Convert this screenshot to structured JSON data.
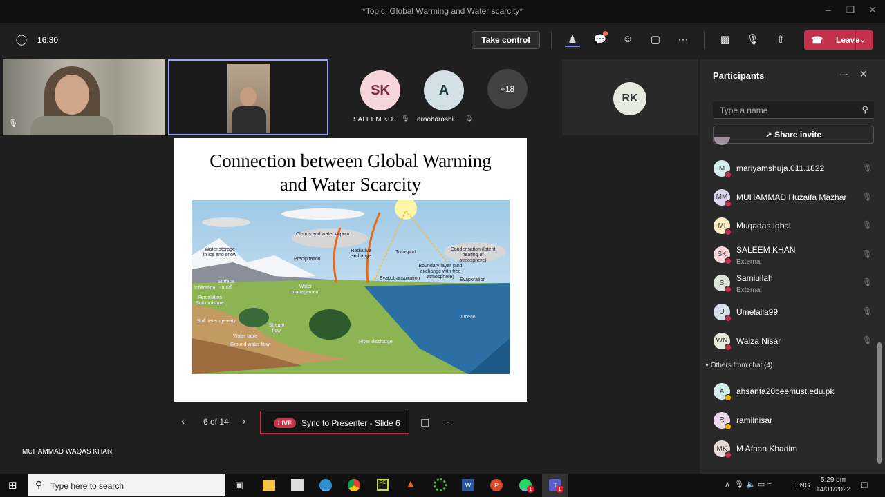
{
  "window": {
    "title": "*Topic: Global Warming and Water scarcity*"
  },
  "toolbar": {
    "timer": "16:30",
    "take_control": "Take control",
    "leave": "Leave"
  },
  "videos": {
    "tiles": [
      {
        "name": "SALEEM KH...",
        "initials": "SK",
        "bg": "#f6d6db",
        "fg": "#7a2a3a"
      },
      {
        "name": "aroobarashi...",
        "initials": "A",
        "bg": "#d3e1e6",
        "fg": "#1f3b48"
      }
    ],
    "overflow": "+18",
    "rk": {
      "initials": "RK",
      "bg": "#e6ebdd",
      "fg": "#333"
    }
  },
  "slide": {
    "title_line1": "Connection between Global Warming",
    "title_line2": "and Water Scarcity",
    "labels": {
      "clouds": "Clouds and water vapour",
      "radiative": "Radiative exchange",
      "transport": "Transport",
      "condensation": "Condensation (latent heating of atmosphere)",
      "storage": "Water storage in ice and snow",
      "precipitation": "Precipitation",
      "boundary": "Boundary layer (and exchange with free atmosphere)",
      "evapotranspiration": "Evapotranspiration",
      "evaporation": "Evaporation",
      "runoff": "Surface runoff",
      "management": "Water management",
      "infiltration": "Infiltration",
      "percolation": "Percolation Soil moisture",
      "soil": "Soil heterogeneity",
      "stream": "Stream flow",
      "ocean": "Ocean",
      "table": "Water table",
      "ground": "Ground water flow",
      "river": "River discharge"
    }
  },
  "slide_nav": {
    "page": "6 of 14",
    "live": "LIVE",
    "sync": "Sync to Presenter - Slide 6"
  },
  "presenter": "MUHAMMAD WAQAS KHAN",
  "panel": {
    "title": "Participants",
    "search_placeholder": "Type a name",
    "share": "Share invite",
    "participants": [
      {
        "initials": "M",
        "name": "mariyamshuja.011.1822",
        "sub": "",
        "bg": "#d3ecec"
      },
      {
        "initials": "MM",
        "name": "MUHAMMAD Huzaifa Mazhar",
        "sub": "",
        "bg": "#dcd6ef"
      },
      {
        "initials": "MI",
        "name": "Muqadas Iqbal",
        "sub": "",
        "bg": "#fbedc4"
      },
      {
        "initials": "SK",
        "name": "SALEEM KHAN",
        "sub": "External",
        "bg": "#f6d6db"
      },
      {
        "initials": "S",
        "name": "Samiullah",
        "sub": "External",
        "bg": "#dde5d8"
      },
      {
        "initials": "U",
        "name": "Umelaila99",
        "sub": "",
        "bg": "#d6e0ef"
      },
      {
        "initials": "WN",
        "name": "Waiza Nisar",
        "sub": "",
        "bg": "#e6ebdd"
      }
    ],
    "others_header": "Others from chat (4)",
    "others": [
      {
        "initials": "A",
        "name": "ahsanfa20beemust.edu.pk",
        "bg": "#d3ecec",
        "status": "#f0b400"
      },
      {
        "initials": "R",
        "name": "ramilnisar",
        "bg": "#ecd6ea",
        "status": "#f0b400"
      },
      {
        "initials": "MK",
        "name": "M Afnan Khadim",
        "bg": "#ecdcd6",
        "status": "#c4314b"
      }
    ]
  },
  "taskbar": {
    "search": "Type here to search",
    "lang": "ENG",
    "time": "5:29 pm",
    "date": "14/01/2022",
    "badge": "1"
  },
  "colors": {
    "accent": "#6264a7",
    "leave": "#c4314b",
    "busy": "#c4314b"
  }
}
